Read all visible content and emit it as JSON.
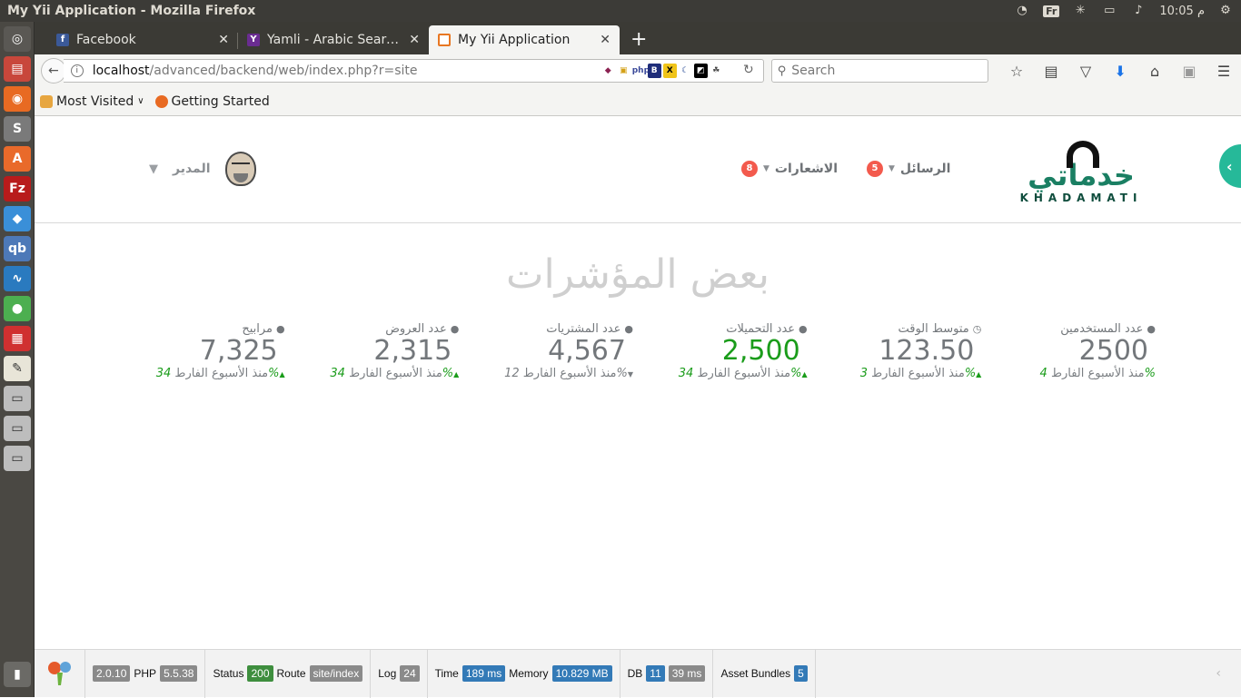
{
  "os": {
    "window_title": "My Yii Application - Mozilla Firefox",
    "keyboard_indicator": "Fr",
    "clock": "10:05 م"
  },
  "browser": {
    "tabs": [
      {
        "label": "Facebook",
        "active": false
      },
      {
        "label": "Yamli - Arabic Search...",
        "active": false
      },
      {
        "label": "My Yii Application",
        "active": true
      }
    ],
    "url_host": "localhost",
    "url_path": "/advanced/backend/web/index.php?r=site",
    "search_placeholder": "Search",
    "bookmarks": [
      {
        "label": "Most Visited"
      },
      {
        "label": "Getting Started"
      }
    ]
  },
  "app": {
    "logo_ar": "خدماتي",
    "logo_en": "KHADAMATI",
    "nav": {
      "messages_label": "الرسائل",
      "messages_count": "5",
      "notifications_label": "الاشعارات",
      "notifications_count": "8",
      "user_label": "المدير"
    },
    "heading": "بعض المؤشرات",
    "stats": [
      {
        "label": "عدد المستخدمين",
        "value": "2500",
        "pct": "4%",
        "suffix": "منذ الأسبوع الفارط",
        "trend": "none"
      },
      {
        "label": "متوسط الوقت",
        "value": "123.50",
        "pct": "3%",
        "suffix": "منذ الأسبوع الفارط",
        "trend": "up"
      },
      {
        "label": "عدد التحميلات",
        "value": "2,500",
        "pct": "34%",
        "suffix": "منذ الأسبوع الفارط",
        "trend": "up"
      },
      {
        "label": "عدد المشتريات",
        "value": "4,567",
        "pct": "12%",
        "suffix": "منذ الأسبوع الفارط",
        "trend": "down"
      },
      {
        "label": "عدد العروض",
        "value": "2,315",
        "pct": "34%",
        "suffix": "منذ الأسبوع الفارط",
        "trend": "up"
      },
      {
        "label": "مرابيح",
        "value": "7,325",
        "pct": "34%",
        "suffix": "منذ الأسبوع الفارط",
        "trend": "up"
      }
    ]
  },
  "debug": {
    "yii_version": "2.0.10",
    "php_label": "PHP",
    "php_version": "5.5.38",
    "status_label": "Status",
    "status_code": "200",
    "route_label": "Route",
    "route": "site/index",
    "log_label": "Log",
    "log_count": "24",
    "time_label": "Time",
    "time": "189 ms",
    "memory_label": "Memory",
    "memory": "10.829 MB",
    "db_label": "DB",
    "db_queries": "11",
    "db_time": "39 ms",
    "assets_label": "Asset Bundles",
    "assets_count": "5"
  }
}
